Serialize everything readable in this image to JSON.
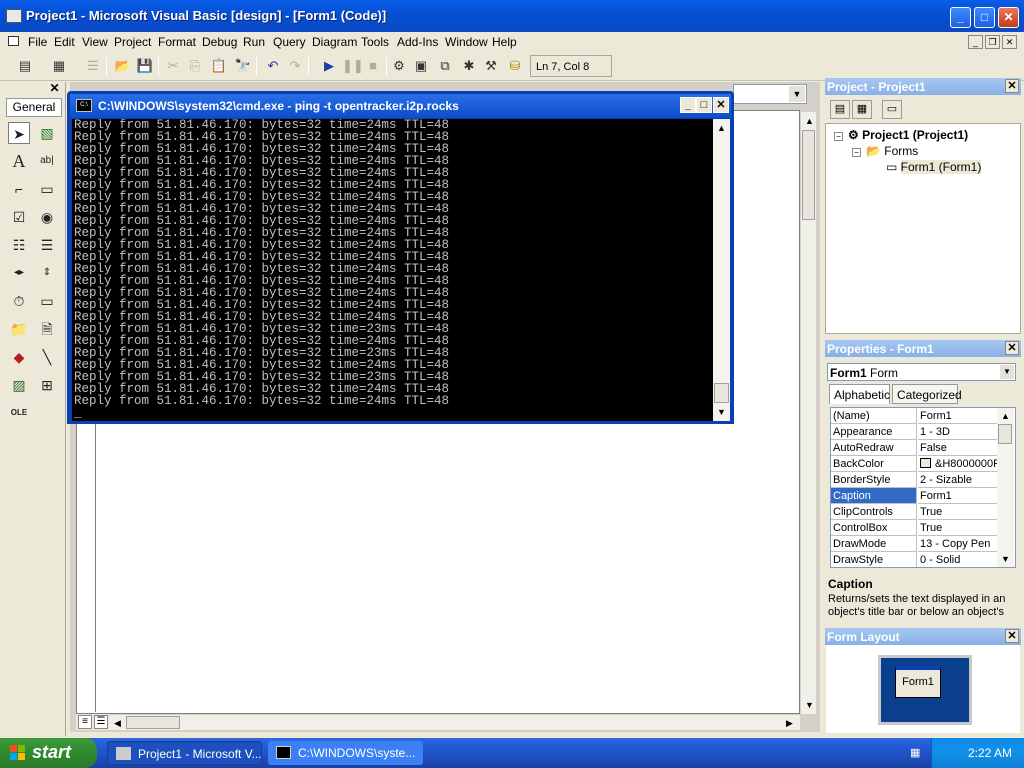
{
  "window": {
    "title": "Project1 - Microsoft Visual Basic [design] - [Form1 (Code)]",
    "minimize": "_",
    "maximize": "□",
    "close": "✕"
  },
  "menu": {
    "items": [
      {
        "label": "File",
        "hot": "F"
      },
      {
        "label": "Edit",
        "hot": "E"
      },
      {
        "label": "View",
        "hot": "V"
      },
      {
        "label": "Project",
        "hot": "P"
      },
      {
        "label": "Format",
        "hot": "o"
      },
      {
        "label": "Debug",
        "hot": "D"
      },
      {
        "label": "Run",
        "hot": "R"
      },
      {
        "label": "Query",
        "hot": "Q"
      },
      {
        "label": "Diagram",
        "hot": "i"
      },
      {
        "label": "Tools",
        "hot": "T"
      },
      {
        "label": "Add-Ins",
        "hot": "A"
      },
      {
        "label": "Window",
        "hot": "W"
      },
      {
        "label": "Help",
        "hot": "H"
      }
    ]
  },
  "toolbar": {
    "position_label": "Ln 7, Col 8"
  },
  "toolbox": {
    "tab_label": "General"
  },
  "cmd": {
    "title": "C:\\WINDOWS\\system32\\cmd.exe - ping -t opentracker.i2p.rocks",
    "lines": [
      "Reply from 51.81.46.170: bytes=32 time=24ms TTL=48",
      "Reply from 51.81.46.170: bytes=32 time=24ms TTL=48",
      "Reply from 51.81.46.170: bytes=32 time=24ms TTL=48",
      "Reply from 51.81.46.170: bytes=32 time=24ms TTL=48",
      "Reply from 51.81.46.170: bytes=32 time=24ms TTL=48",
      "Reply from 51.81.46.170: bytes=32 time=24ms TTL=48",
      "Reply from 51.81.46.170: bytes=32 time=24ms TTL=48",
      "Reply from 51.81.46.170: bytes=32 time=24ms TTL=48",
      "Reply from 51.81.46.170: bytes=32 time=24ms TTL=48",
      "Reply from 51.81.46.170: bytes=32 time=24ms TTL=48",
      "Reply from 51.81.46.170: bytes=32 time=24ms TTL=48",
      "Reply from 51.81.46.170: bytes=32 time=24ms TTL=48",
      "Reply from 51.81.46.170: bytes=32 time=24ms TTL=48",
      "Reply from 51.81.46.170: bytes=32 time=24ms TTL=48",
      "Reply from 51.81.46.170: bytes=32 time=24ms TTL=48",
      "Reply from 51.81.46.170: bytes=32 time=24ms TTL=48",
      "Reply from 51.81.46.170: bytes=32 time=24ms TTL=48",
      "Reply from 51.81.46.170: bytes=32 time=23ms TTL=48",
      "Reply from 51.81.46.170: bytes=32 time=24ms TTL=48",
      "Reply from 51.81.46.170: bytes=32 time=23ms TTL=48",
      "Reply from 51.81.46.170: bytes=32 time=24ms TTL=48",
      "Reply from 51.81.46.170: bytes=32 time=23ms TTL=48",
      "Reply from 51.81.46.170: bytes=32 time=24ms TTL=48",
      "Reply from 51.81.46.170: bytes=32 time=24ms TTL=48",
      "_"
    ]
  },
  "project": {
    "title": "Project - Project1",
    "root": "Project1 (Project1)",
    "folder": "Forms",
    "form": "Form1 (Form1)"
  },
  "properties": {
    "title": "Properties - Form1",
    "object_name": "Form1",
    "object_type": "Form",
    "tabs": [
      "Alphabetic",
      "Categorized"
    ],
    "rows": [
      {
        "name": "(Name)",
        "value": "Form1"
      },
      {
        "name": "Appearance",
        "value": "1 - 3D"
      },
      {
        "name": "AutoRedraw",
        "value": "False"
      },
      {
        "name": "BackColor",
        "value": "&H8000000F"
      },
      {
        "name": "BorderStyle",
        "value": "2 - Sizable"
      },
      {
        "name": "Caption",
        "value": "Form1"
      },
      {
        "name": "ClipControls",
        "value": "True"
      },
      {
        "name": "ControlBox",
        "value": "True"
      },
      {
        "name": "DrawMode",
        "value": "13 - Copy Pen"
      },
      {
        "name": "DrawStyle",
        "value": "0 - Solid"
      }
    ],
    "desc_title": "Caption",
    "desc_text": "Returns/sets the text displayed in an object's title bar or below an object's"
  },
  "form_layout": {
    "title": "Form Layout",
    "form_label": "Form1"
  },
  "taskbar": {
    "start": "start",
    "tasks": [
      "Project1 - Microsoft V...",
      "C:\\WINDOWS\\syste..."
    ],
    "clock": "2:22 AM"
  },
  "colors": {
    "title_blue": "#0550d6",
    "taskbar_blue": "#245edb",
    "start_green": "#2e8a2e",
    "selection": "#316ac5"
  }
}
